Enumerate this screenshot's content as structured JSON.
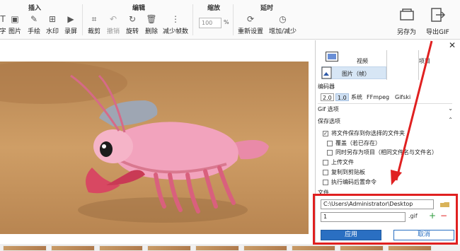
{
  "toolbar": {
    "groups": {
      "insert": "插入",
      "edit": "编辑",
      "zoom": "缩放",
      "delay": "延时"
    },
    "insert_items": [
      "字",
      "图片",
      "手绘",
      "水印",
      "录屏"
    ],
    "edit_items": [
      "裁剪",
      "撤销",
      "旋转",
      "删除",
      "减少帧数"
    ],
    "zoom_value": "100",
    "zoom_unit": "%",
    "delay_items": [
      "重新设置",
      "增加/减少"
    ],
    "save_as": "另存为",
    "export_gif": "导出GIF"
  },
  "panel": {
    "tab_video": "视频",
    "tab_image": "图片（帧）",
    "project_label": "项目",
    "encoder": {
      "title": "编码器",
      "options": [
        "2.0",
        "1.0",
        "系统",
        "FFmpeg",
        "Gifski"
      ]
    },
    "gif_options": "Gif 选项",
    "save_options": {
      "title": "保存选项",
      "checks": [
        {
          "label": "将文件保存到你选择的文件夹",
          "checked": "✓"
        },
        {
          "label": "覆盖（若已存在）",
          "checked": ""
        },
        {
          "label": "同时另存为项目（相同文件名与文件名）",
          "checked": ""
        },
        {
          "label": "上传文件",
          "checked": ""
        },
        {
          "label": "复制到剪贴板",
          "checked": ""
        },
        {
          "label": "执行编码后置命令",
          "checked": ""
        }
      ]
    },
    "file": {
      "title": "文件",
      "path": "C:\\Users\\Administrator\\Desktop",
      "name": "1",
      "ext": ".gif",
      "apply": "应用",
      "cancel": "取消"
    }
  },
  "colors": {
    "accent": "#2a6fc2",
    "annotation": "#e02020",
    "selected_tab": "#d7e6f5"
  }
}
